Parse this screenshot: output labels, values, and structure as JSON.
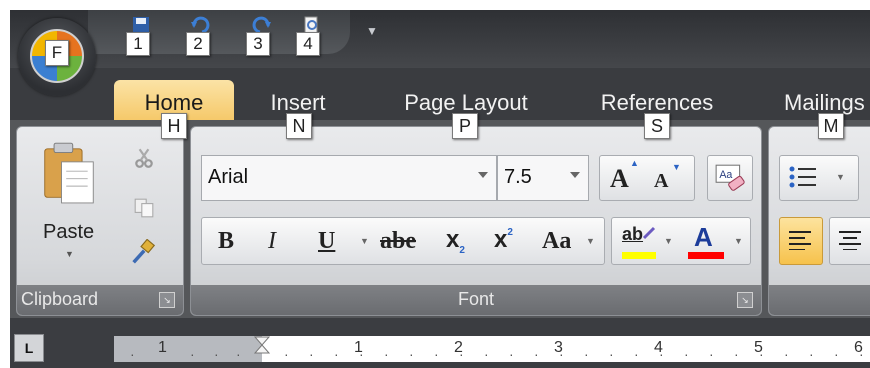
{
  "office_button": {
    "keytip": "F"
  },
  "quick_access": [
    {
      "icon": "save-icon",
      "keytip": "1"
    },
    {
      "icon": "undo-icon",
      "keytip": "2"
    },
    {
      "icon": "redo-icon",
      "keytip": "3"
    },
    {
      "icon": "print-preview-icon",
      "keytip": "4"
    }
  ],
  "tabs": [
    {
      "label": "Home",
      "keytip": "H",
      "active": true
    },
    {
      "label": "Insert",
      "keytip": "N"
    },
    {
      "label": "Page Layout",
      "keytip": "P"
    },
    {
      "label": "References",
      "keytip": "S"
    },
    {
      "label": "Mailings",
      "keytip": "M"
    }
  ],
  "clipboard": {
    "title": "Clipboard",
    "paste_label": "Paste"
  },
  "font": {
    "title": "Font",
    "font_name": "Arial",
    "font_size": "7.5",
    "grow_label": "A",
    "shrink_label": "A",
    "bold_label": "B",
    "italic_label": "I",
    "underline_label": "U",
    "strike_label": "abe",
    "subscript_label": "x",
    "subscript_mark": "2",
    "superscript_label": "x",
    "superscript_mark": "2",
    "case_label": "Aa",
    "highlight_label": "ab",
    "color_label": "A",
    "highlight_color": "#ffff00",
    "font_color": "#ff0000"
  },
  "ruler": {
    "left_marks": [
      "1"
    ],
    "numbers": [
      "1",
      "2",
      "3",
      "4",
      "5",
      "6"
    ]
  },
  "colors": {
    "active_tab": "#f6c96a",
    "ribbon_bg": "#55575a",
    "titlebar_bg": "#3a3c40"
  }
}
